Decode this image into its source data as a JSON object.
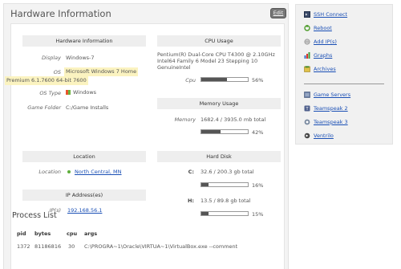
{
  "page": {
    "title": "Hardware Information",
    "edit_label": "Edit"
  },
  "hardware": {
    "header": "Hardware Information",
    "display_label": "Display",
    "display_value": "Windows-7",
    "os_label": "OS",
    "os_value_1": "Microsoft Windows 7 Home",
    "os_value_2": "Premium 6.1.7600 64-bit 7600",
    "os_type_label": "OS Type",
    "os_type_value": "Windows",
    "game_folder_label": "Game Folder",
    "game_folder_value": "C:/Game Installs"
  },
  "cpu": {
    "header": "CPU Usage",
    "line1": "Pentium(R) Dual-Core CPU T4300 @ 2.10GHz",
    "line2": "Intel64 Family 6 Model 23 Stepping 10",
    "line3": "GenuineIntel",
    "label": "Cpu",
    "percent_text": "56%",
    "percent": 56
  },
  "memory": {
    "header": "Memory Usage",
    "label": "Memory",
    "value": "1682.4 / 3935.0 mb total",
    "percent_text": "42%",
    "percent": 42
  },
  "location": {
    "header": "Location",
    "label": "Location",
    "value": "North Central, MN"
  },
  "ip": {
    "header": "IP Address(es)",
    "label": "IP(s)",
    "value": "192.168.56.1"
  },
  "disk": {
    "header": "Hard Disk",
    "c_label": "C:",
    "c_value": "32.6 / 200.3 gb total",
    "c_percent_text": "16%",
    "c_percent": 16,
    "h_label": "H:",
    "h_value": "13.5 / 89.8 gb total",
    "h_percent_text": "15%",
    "h_percent": 15
  },
  "process": {
    "title": "Process List",
    "columns": [
      "pid",
      "bytes",
      "cpu",
      "args"
    ],
    "rows": [
      {
        "pid": "1372",
        "bytes": "81186816",
        "cpu": "30",
        "args_1": "C:\\PROGRA~1\\Oracle\\VIRTUA~1\\VirtualBox.exe --comment"
      }
    ]
  },
  "sidebar": {
    "items": [
      {
        "label": "SSH Connect",
        "icon": "terminal-icon"
      },
      {
        "label": "Reboot",
        "icon": "reboot-icon"
      },
      {
        "label": "Add IP(s)",
        "icon": "add-ip-icon"
      },
      {
        "label": "Graphs",
        "icon": "graph-icon"
      },
      {
        "label": "Archives",
        "icon": "archive-icon"
      },
      {
        "label": "Game Servers",
        "icon": "server-icon"
      },
      {
        "label": "Teamspeak 2",
        "icon": "teamspeak-icon"
      },
      {
        "label": "Teamspeak 3",
        "icon": "teamspeak3-icon"
      },
      {
        "label": "Ventrilo",
        "icon": "ventrilo-icon"
      }
    ]
  },
  "colors": {
    "link": "#1a4fb5",
    "bar_fill": "#555555",
    "os_highlight": "#fbf3c0",
    "location_dot": "#5fae3c"
  }
}
